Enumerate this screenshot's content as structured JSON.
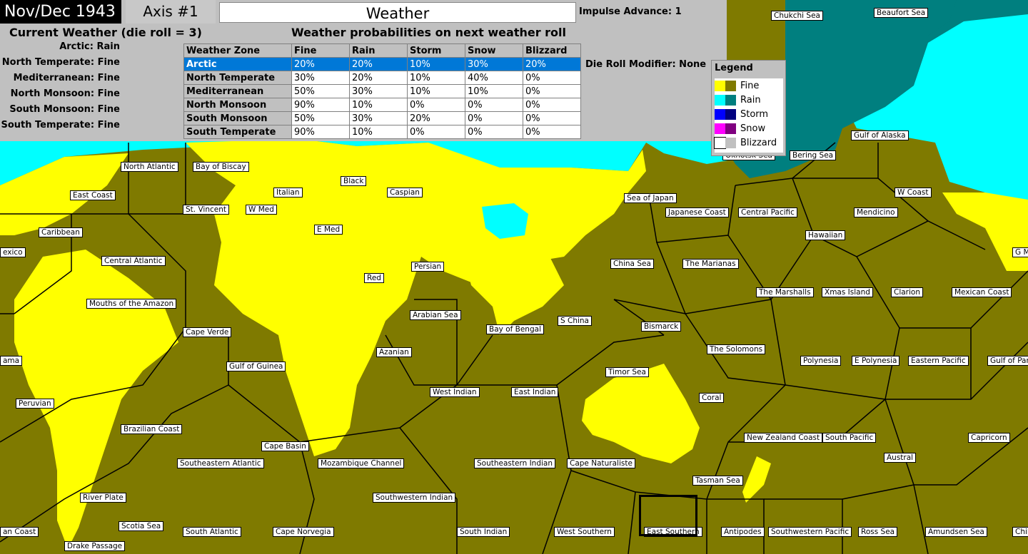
{
  "header": {
    "date": "Nov/Dec 1943",
    "axis": "Axis #1",
    "title": "Weather",
    "impulse": "Impulse Advance:  1",
    "die_modifier": "Die Roll Modifier:  None"
  },
  "current_weather": {
    "title": "Current Weather (die roll = 3)",
    "zones": [
      {
        "label": "Arctic:",
        "value": "Rain"
      },
      {
        "label": "North Temperate:",
        "value": "Fine"
      },
      {
        "label": "Mediterranean:",
        "value": "Fine"
      },
      {
        "label": "North Monsoon:",
        "value": "Fine"
      },
      {
        "label": "South Monsoon:",
        "value": "Fine"
      },
      {
        "label": "South Temperate:",
        "value": "Fine"
      }
    ]
  },
  "probabilities": {
    "title": "Weather probabilities on next weather roll",
    "headers": [
      "Weather Zone",
      "Fine",
      "Rain",
      "Storm",
      "Snow",
      "Blizzard"
    ],
    "rows": [
      [
        "Arctic",
        "20%",
        "20%",
        "10%",
        "30%",
        "20%"
      ],
      [
        "North Temperate",
        "30%",
        "20%",
        "10%",
        "40%",
        "0%"
      ],
      [
        "Mediterranean",
        "50%",
        "30%",
        "10%",
        "10%",
        "0%"
      ],
      [
        "North Monsoon",
        "90%",
        "10%",
        "0%",
        "0%",
        "0%"
      ],
      [
        "South Monsoon",
        "50%",
        "30%",
        "20%",
        "0%",
        "0%"
      ],
      [
        "South Temperate",
        "90%",
        "10%",
        "0%",
        "0%",
        "0%"
      ]
    ]
  },
  "legend": {
    "title": "Legend",
    "items": [
      {
        "label": "Fine",
        "c1": "#ffff00",
        "c2": "#7f7a00"
      },
      {
        "label": "Rain",
        "c1": "#00ffff",
        "c2": "#007f7f"
      },
      {
        "label": "Storm",
        "c1": "#0000ff",
        "c2": "#00007f"
      },
      {
        "label": "Snow",
        "c1": "#ff00ff",
        "c2": "#7f007f"
      },
      {
        "label": "Blizzard",
        "c1": "#ffffff",
        "c2": "#c0c0c0"
      }
    ]
  },
  "sea_areas": [
    "Chukchi Sea",
    "Beaufort Sea",
    "North Atlantic",
    "Bay of Biscay",
    "East Coast",
    "Italian",
    "Black",
    "Caspian",
    "Sea of Japan",
    "W Coast",
    "St. Vincent",
    "W Med",
    "Japanese Coast",
    "Central Pacific",
    "Mendicino",
    "Caribbean",
    "E Med",
    "Hawaiian",
    "exico",
    "G M",
    "Central Atlantic",
    "China Sea",
    "The Marianas",
    "Persian",
    "Red",
    "The Marshalls",
    "Xmas Island",
    "Clarion",
    "Mexican Coast",
    "Mouths of the Amazon",
    "Arabian Sea",
    "S China",
    "Bay of Bengal",
    "Bismarck",
    "Cape Verde",
    "The Solomons",
    "Azanian",
    "Polynesia",
    "E Polynesia",
    "Eastern Pacific",
    "Gulf of Pan",
    "ama",
    "Gulf of Guinea",
    "Timor Sea",
    "West Indian",
    "East Indian",
    "Coral",
    "Peruvian",
    "Brazilian Coast",
    "New Zealand Coast",
    "South Pacific",
    "Capricorn",
    "Cape Basin",
    "Austral",
    "Southeastern Atlantic",
    "Mozambique Channel",
    "Southeastern Indian",
    "Cape Naturaliste",
    "Tasman Sea",
    "River Plate",
    "Southwestern Indian",
    "an Coast",
    "Scotia Sea",
    "South Atlantic",
    "Cape Norvegia",
    "South Indian",
    "West Southern",
    "East Southern",
    "Antipodes",
    "Southwestern Pacific",
    "Ross Sea",
    "Amundsen Sea",
    "Chile",
    "Drake Passage",
    "Gulf of Alaska",
    "Okhotsk Sea",
    "Bering Sea"
  ]
}
